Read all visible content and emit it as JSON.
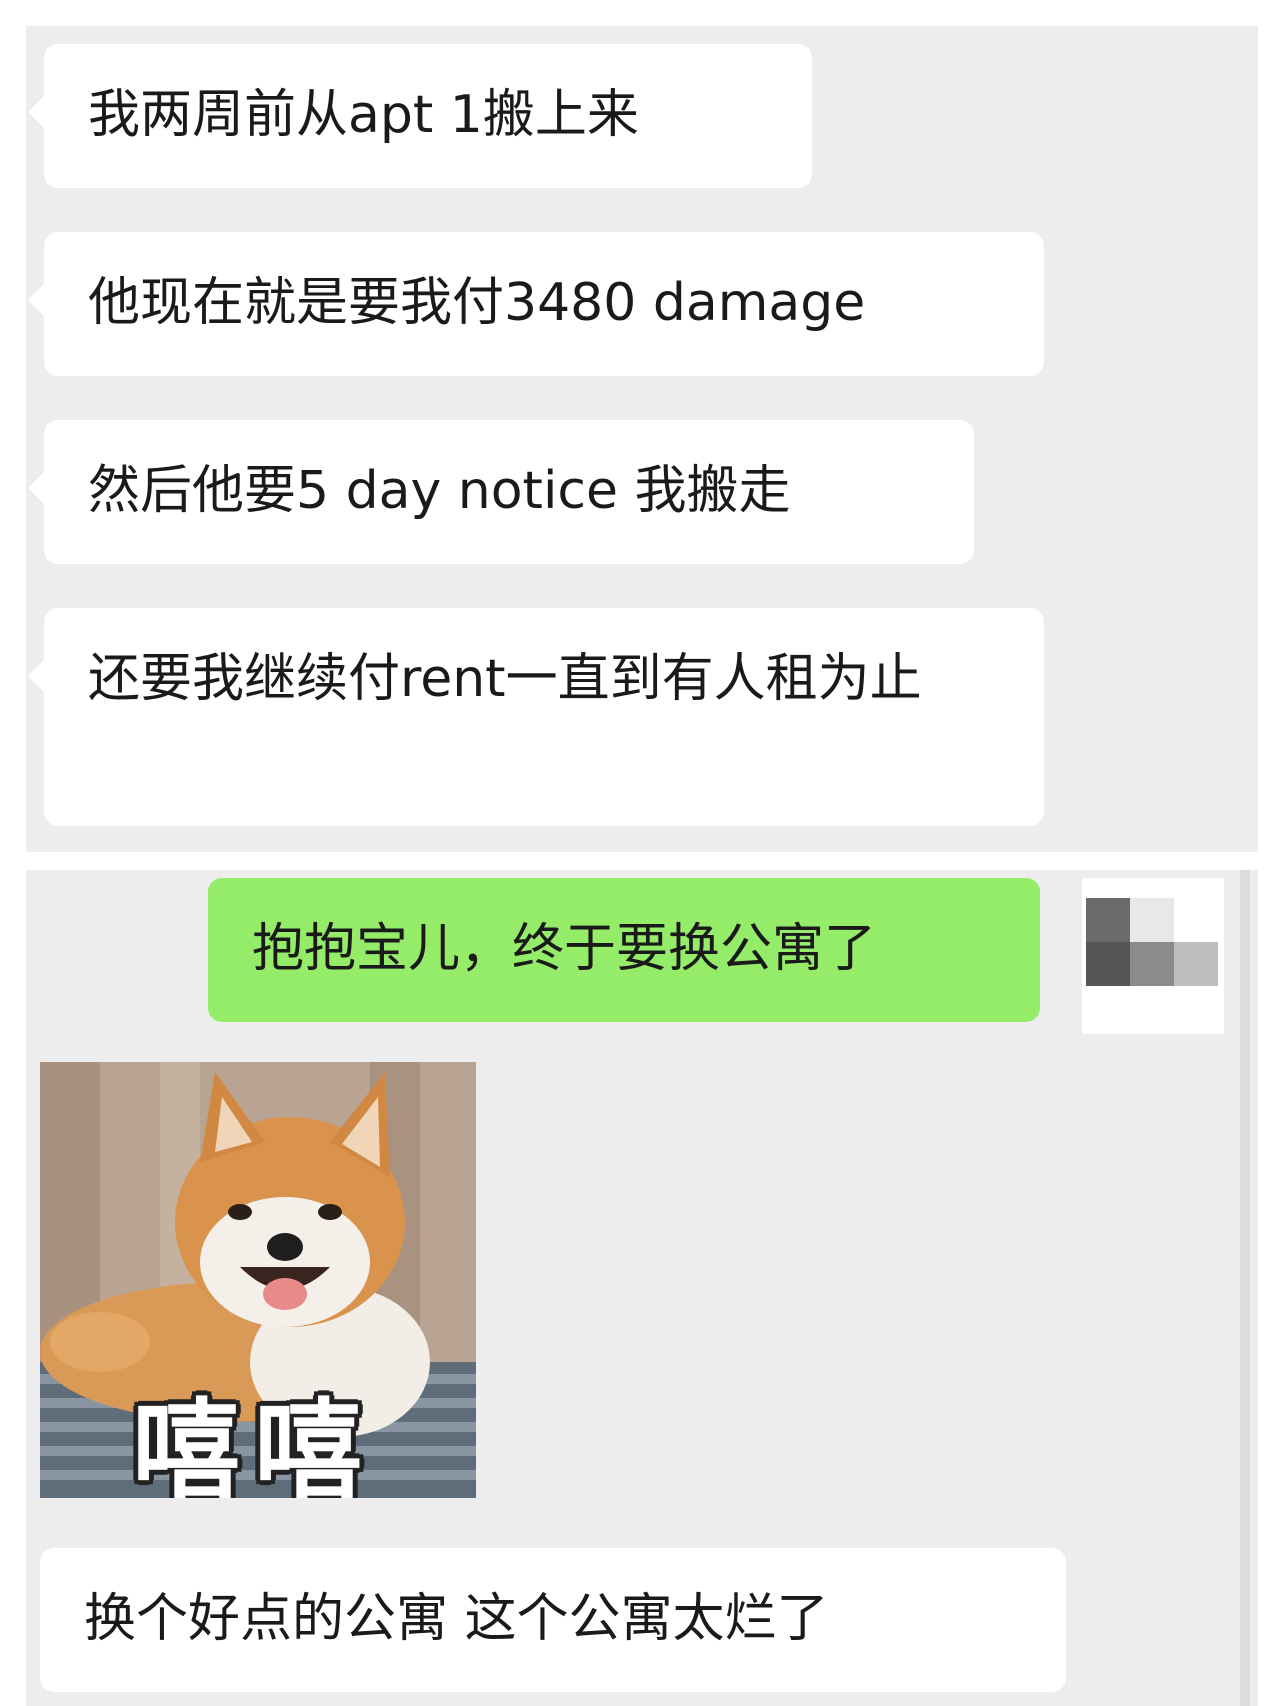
{
  "messages_top": [
    {
      "side": "in",
      "text": "我两周前从apt  1搬上来"
    },
    {
      "side": "in",
      "text": "他现在就是要我付3480  damage"
    },
    {
      "side": "in",
      "text": "然后他要5  day  notice 我搬走"
    },
    {
      "side": "in",
      "text": "还要我继续付rent一直到有人租为止"
    }
  ],
  "messages_bottom": [
    {
      "side": "out",
      "text": "抱抱宝儿，终于要换公寓了"
    },
    {
      "side": "in",
      "type": "sticker",
      "icon": "shiba-dog-sticker",
      "caption": "嘻嘻"
    },
    {
      "side": "in",
      "text": "换个好点的公寓  这个公寓太烂了"
    }
  ],
  "colors": {
    "chat_background": "#ededed",
    "incoming_bubble": "#ffffff",
    "outgoing_bubble": "#95ec69"
  }
}
